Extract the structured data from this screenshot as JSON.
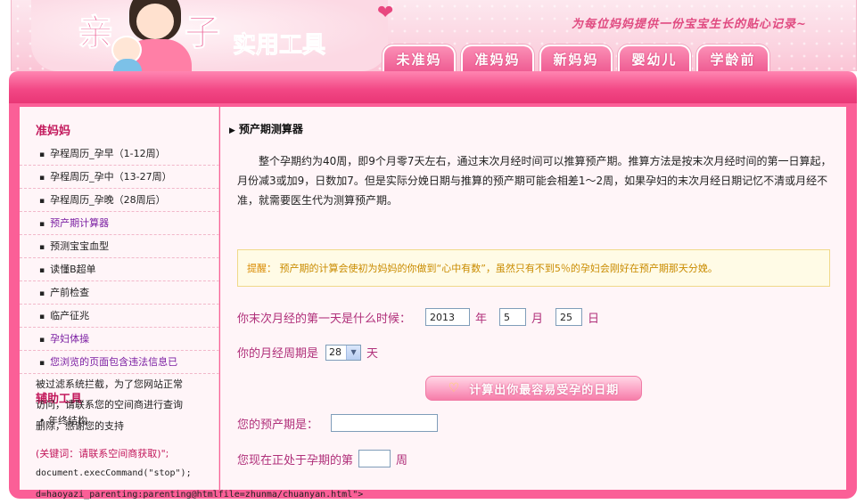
{
  "header": {
    "logo_char_1": "亲",
    "logo_char_2": "子",
    "logo_subtitle": "实用工具",
    "slogan": "为每位妈妈提供一份宝宝生长的贴心记录~",
    "tabs": [
      "未准妈",
      "准妈妈",
      "新妈妈",
      "婴幼儿",
      "学龄前"
    ]
  },
  "sidebar": {
    "heading": "准妈妈",
    "items": [
      "孕程周历_孕早（1-12周）",
      "孕程周历_孕中（13-27周）",
      "孕程周历_孕晚（28周后）",
      "预产期计算器",
      "预测宝宝血型",
      "读懂B超单",
      "产前检查",
      "临产征兆",
      "孕妇体操",
      "您浏览的页面包含违法信息已"
    ],
    "heading2": "辅助工具",
    "overlay_lines": [
      "被过滤系统拦截，为了您网站正常",
      "访问，请联系您的空间商进行查询",
      "删除，感谢您的支持"
    ],
    "item_small": "• 年终结构",
    "code_lines": [
      "(关键词：请联系空间商获取)\";",
      "document.execCommand(\"stop\");",
      "d=haoyazi_parenting:parenting@htmlfile=zhunma/chuanyan.html\">"
    ]
  },
  "main": {
    "title": "预产期测算器",
    "intro": "整个孕期约为40周，即9个月零7天左右，通过末次月经时间可以推算预产期。推算方法是按末次月经时间的第一日算起，月份减3或加9，日数加7。但是实际分娩日期与推算的预产期可能会相差1～2周，如果孕妇的末次月经日期记忆不清或月经不准，就需要医生代为测算预产期。",
    "tip_label": "提醒：",
    "tip_text": "预产期的计算会使初为妈妈的你做到“心中有数”，虽然只有不到5％的孕妇会刚好在预产期那天分娩。",
    "form": {
      "lmp_label": "你末次月经的第一天是什么时候：",
      "year_value": "2013",
      "year_unit": "年",
      "month_value": "5",
      "month_unit": "月",
      "day_value": "25",
      "day_unit": "日",
      "cycle_label": "你的月经周期是",
      "cycle_value": "28",
      "cycle_unit": "天",
      "calc_button": "计算出你最容易受孕的日期",
      "due_label": "您的预产期是：",
      "due_value": "",
      "week_label": "您现在正处于孕期的第",
      "week_value": "",
      "week_unit": "周"
    }
  },
  "colors": {
    "brand_pink": "#f24785",
    "sidebar_heading": "#c2185b",
    "form_label": "#b0307a",
    "tip_text": "#c98b00"
  },
  "icons": {
    "calc_button_icon": "heart-outline-icon",
    "title_icon": "triangle-right-icon",
    "select_icon": "chevron-down-icon"
  }
}
